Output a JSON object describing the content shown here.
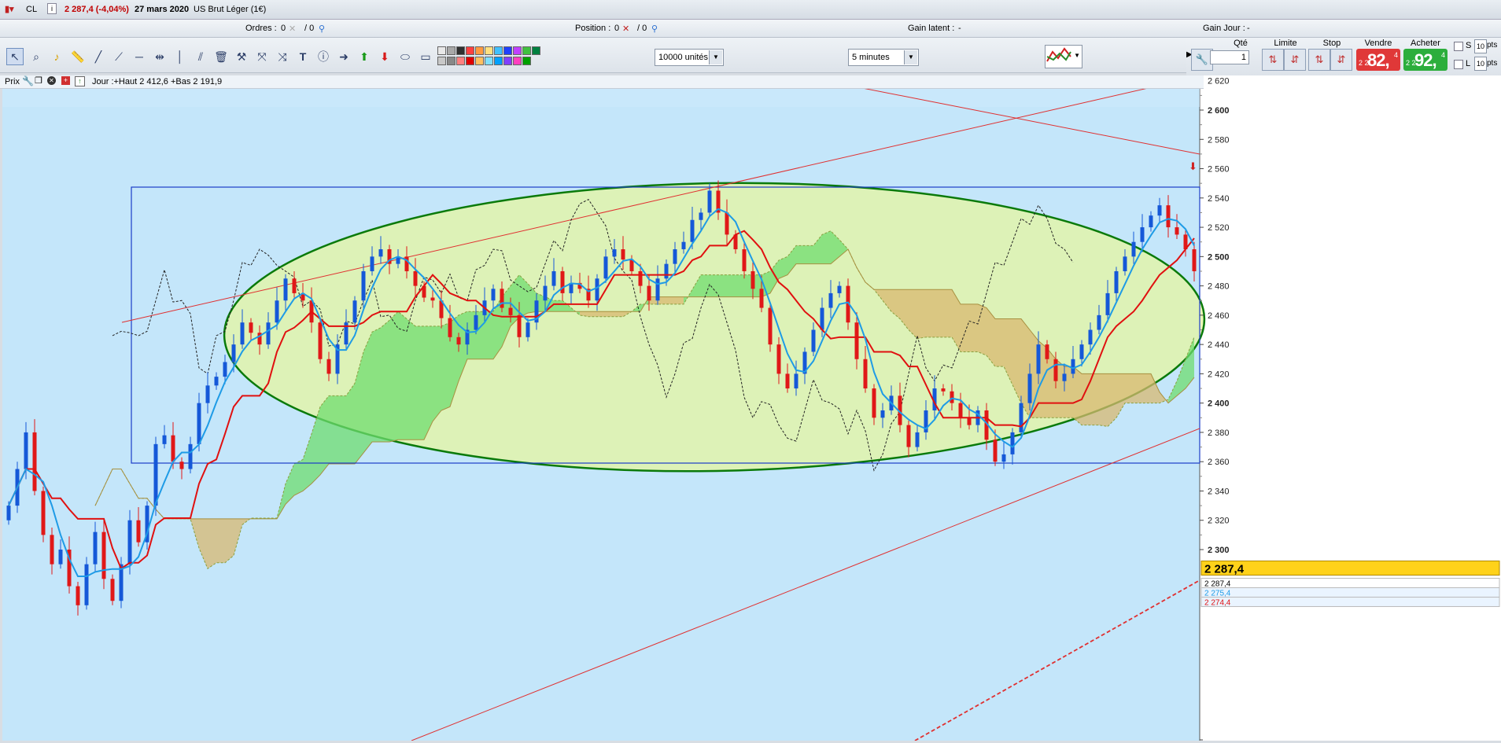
{
  "titlebar": {
    "symbol": "CL",
    "quote": "2 287,4 (-4,04%)",
    "date": "27 mars 2020",
    "instrument": "US Brut Léger (1€)"
  },
  "statusbar": {
    "orders_label": "Ordres :",
    "orders_value": "0",
    "orders_total": "/ 0",
    "position_label": "Position :",
    "position_value": "0",
    "position_total": "/ 0",
    "gain_latent_label": "Gain latent :",
    "gain_latent_value": "-",
    "gain_jour_label": "Gain Jour :",
    "gain_jour_value": "-"
  },
  "toolbar": {
    "units_select": "10000 unités",
    "interval_select": "5 minutes",
    "swatch_colors": [
      "#e8e8e8",
      "#c8c8c8",
      "#a8a8a8",
      "#888888",
      "#303030",
      "#ff8080",
      "#ff4040",
      "#e00000",
      "#ff9a40",
      "#ffc060",
      "#ffe080",
      "#80e0ff",
      "#40c0ff",
      "#00a0ff",
      "#2040ff",
      "#8040ff",
      "#c040ff",
      "#ff40c0",
      "#40c040",
      "#00a000",
      "#008040"
    ]
  },
  "order_panel": {
    "qty_label": "Qté",
    "qty_value": "1",
    "limit_label": "Limite",
    "stop_label": "Stop",
    "sell_label": "Vendre",
    "buy_label": "Acheter",
    "sell_small": "2 2",
    "sell_big": "82,",
    "sell_sup": "4",
    "buy_small": "2 2",
    "buy_big": "92,",
    "buy_sup": "4",
    "s_label": "S",
    "l_label": "L",
    "pts_value": "10",
    "pts_label": "pts"
  },
  "infobar": {
    "prix_label": "Prix",
    "day_stats": "Jour :+Haut 2 412,6 +Bas 2 191,9"
  },
  "chart_data": {
    "type": "candlestick",
    "title": "",
    "xlabel": "",
    "ylabel": "",
    "ylim": [
      2255,
      2632
    ],
    "y_ticks": [
      "2 620",
      "2 600",
      "2 580",
      "2 560",
      "2 540",
      "2 520",
      "2 500",
      "2 480",
      "2 460",
      "2 440",
      "2 420",
      "2 400",
      "2 380",
      "2 360",
      "2 340",
      "2 320",
      "2 300"
    ],
    "y_tick_values": [
      2620,
      2600,
      2580,
      2560,
      2540,
      2520,
      2500,
      2480,
      2460,
      2440,
      2420,
      2400,
      2380,
      2360,
      2340,
      2320,
      2300
    ],
    "last_price_label": "2 287,4",
    "last_price_value": 2287.4,
    "mini_labels": [
      "2 287,4",
      "2 275,4",
      "2 274,4"
    ],
    "mini_values": [
      2287.4,
      2275.4,
      2274.4
    ],
    "colors": {
      "up_candle": "#1558d8",
      "down_candle": "#e01818",
      "tenkan": "#e01010",
      "kijun": "#1e9be6",
      "chikou": "#222222",
      "cloud_bull": "#6fdc6f",
      "cloud_bear": "#d8b870",
      "ellipse": "#0a7a0a",
      "ellipse_fill": "#e6f5a0",
      "trendline": "#e03030",
      "rectangle": "#1a3cc8",
      "background": "#c4e6fa"
    },
    "close_series": [
      2330,
      2355,
      2380,
      2340,
      2310,
      2290,
      2300,
      2275,
      2262,
      2290,
      2312,
      2280,
      2265,
      2290,
      2320,
      2305,
      2330,
      2372,
      2378,
      2360,
      2355,
      2372,
      2400,
      2412,
      2418,
      2428,
      2440,
      2455,
      2448,
      2440,
      2455,
      2470,
      2485,
      2475,
      2470,
      2455,
      2430,
      2420,
      2440,
      2455,
      2470,
      2490,
      2500,
      2505,
      2495,
      2500,
      2490,
      2480,
      2472,
      2470,
      2458,
      2445,
      2440,
      2450,
      2460,
      2470,
      2478,
      2465,
      2460,
      2445,
      2455,
      2470,
      2480,
      2490,
      2475,
      2482,
      2478,
      2470,
      2485,
      2500,
      2505,
      2498,
      2490,
      2480,
      2470,
      2485,
      2495,
      2505,
      2510,
      2525,
      2530,
      2545,
      2530,
      2515,
      2505,
      2490,
      2478,
      2465,
      2440,
      2420,
      2410,
      2420,
      2435,
      2450,
      2465,
      2475,
      2480,
      2455,
      2430,
      2410,
      2390,
      2395,
      2405,
      2385,
      2370,
      2380,
      2395,
      2410,
      2408,
      2400,
      2390,
      2385,
      2395,
      2375,
      2360,
      2365,
      2380,
      2400,
      2420,
      2440,
      2430,
      2415,
      2420,
      2430,
      2440,
      2450,
      2460,
      2475,
      2490,
      2500,
      2510,
      2520,
      2528,
      2535,
      2520,
      2515,
      2505,
      2490
    ]
  }
}
